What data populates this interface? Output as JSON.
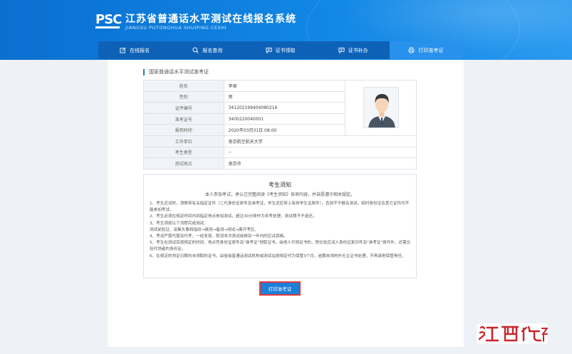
{
  "header": {
    "logo_text": "PSC",
    "title": "江苏省普通话水平测试在线报名系统",
    "subtitle": "JIANGSU PUTONGHUA SHUIPING CESHI"
  },
  "nav": {
    "items": [
      {
        "label": "在线报名",
        "icon": "edit-icon"
      },
      {
        "label": "报名查询",
        "icon": "search-icon"
      },
      {
        "label": "证书领取",
        "icon": "message-icon"
      },
      {
        "label": "证书补办",
        "icon": "message-icon"
      },
      {
        "label": "打印准考证",
        "icon": "printer-icon"
      }
    ],
    "active_index": 4
  },
  "section_title": "国家普通话水平测试准考证",
  "info": {
    "name_label": "姓名",
    "name": "李君",
    "gender_label": "性别",
    "gender": "男",
    "id_label": "证件编号",
    "id": "341202199404080216",
    "ticket_label": "准考证号",
    "ticket": "3400220040001",
    "time_label": "报到时间",
    "time": "2020年03月31日 08:00",
    "org_label": "工作单位",
    "org": "南京航空航天大学",
    "type_label": "考生类型",
    "type": "--",
    "location_label": "测试地点",
    "location": "南京市"
  },
  "notice": {
    "title": "考生须知",
    "intro": "本人参加考试，承认已完整阅读《考生须知》各项内容，并自愿遵守相关规定。",
    "lines": [
      "1、考生应试时，须携带有关指定证件（二代身份证原件及准考证，学生还应带上有效学生证原件），否则不予报名测试。临时身份证及其它证件均不能参加考试。",
      "2、考生必须在规定时间内到指定地点参加测试，超过30分钟作为弃考处理，测试费不予退还。",
      "3、考生须按以下流程完成测试：",
      "测试前验证、采集头像和指纹→候测→备测→测试→离开考区。",
      "4、考试严禁代替及代考，一经发现，取消本次测试成绩及一年内的应试资格。",
      "5、考生在测试后按规定的时间、地点凭身份证原件及\"准考证\"领取证书。由他人代领证书的，除交验应试人身份证复印件及\"准考证\"原件外，还需交验代领者的身份证。",
      "6、在规定的领证日期内未领取的证书，由省级普通话测试机构或测试站按规定代为保管3个月，逾期未领的作无主证书处理，不再承担保管责任。"
    ]
  },
  "print_button": "打印准考证",
  "colors": {
    "header_blue": "#0a6fd0",
    "nav_blue": "#0d62b8",
    "active_tab": "#2891ec",
    "button": "#1e7fd8",
    "highlight": "#e13a3a",
    "watermark_red": "#c8252c"
  }
}
